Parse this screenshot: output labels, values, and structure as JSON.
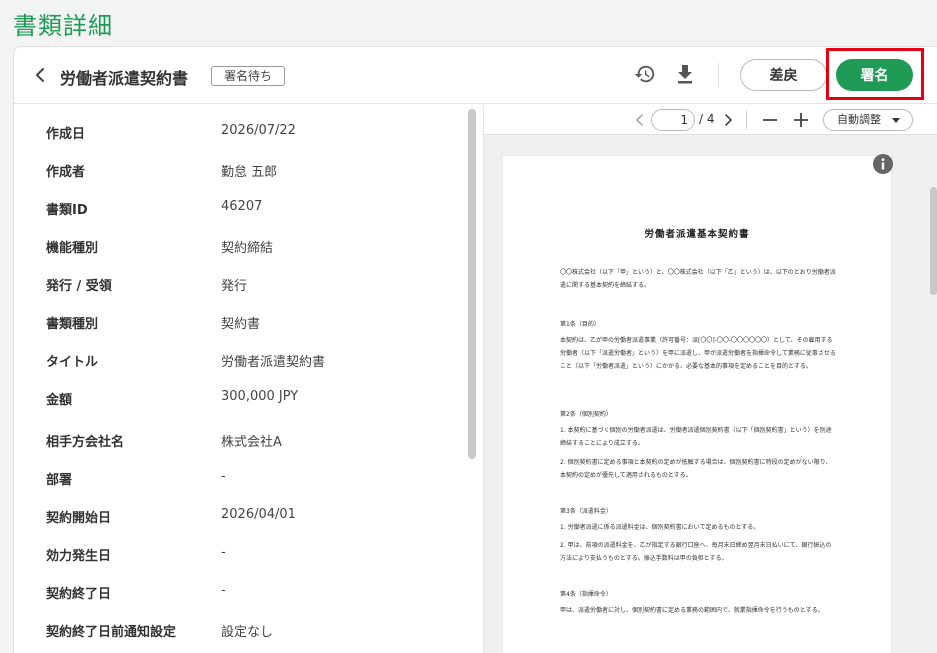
{
  "page_title": "書類詳細",
  "header": {
    "document_title": "労働者派遣契約書",
    "status": "署名待ち",
    "return_label": "差戻",
    "sign_label": "署名"
  },
  "details": [
    {
      "label": "作成日",
      "value": "2026/07/22"
    },
    {
      "label": "作成者",
      "value": "勤怠 五郎"
    },
    {
      "label": "書類ID",
      "value": "46207"
    },
    {
      "label": "機能種別",
      "value": "契約締結"
    },
    {
      "label": "発行 / 受領",
      "value": "発行"
    },
    {
      "label": "書類種別",
      "value": "契約書"
    },
    {
      "label": "タイトル",
      "value": "労働者派遣契約書"
    },
    {
      "label": "金額",
      "value": "300,000 JPY"
    },
    {
      "label": "相手方会社名",
      "value": "株式会社A"
    },
    {
      "label": "部署",
      "value": "-"
    },
    {
      "label": "契約開始日",
      "value": "2026/04/01"
    },
    {
      "label": "効力発生日",
      "value": "-"
    },
    {
      "label": "契約終了日",
      "value": "-"
    },
    {
      "label": "契約終了日前通知設定",
      "value": "設定なし"
    }
  ],
  "viewer": {
    "current_page": "1",
    "total_pages": "/ 4",
    "zoom_label": "自動調整"
  },
  "pdf": {
    "title": "労働者派遣基本契約書",
    "intro": "〇〇株式会社（以下「甲」という）と、〇〇株式会社（以下「乙」という）は、以下のとおり労働者派遣に関する基本契約を締結する。",
    "art1_heading": "第1条（目的）",
    "art1_text": "本契約は、乙が甲の労働者派遣事業（許可番号：派[〇〇]-〇〇-〇〇〇〇〇〇）として、その雇用する労働者（以下「派遣労働者」という）を甲に派遣し、甲が派遣労働者を指揮命令して業務に従事させること（以下「労働者派遣」という）にかかる、必要な基本的事項を定めることを目的とする。",
    "art2_heading": "第2条（個別契約）",
    "art2_text1": "1. 本契約に基づく個別の労働者派遣は、労働者派遣個別契約書（以下「個別契約書」という）を別途締結することにより成立する。",
    "art2_text2": "2. 個別契約書に定める事項と本契約の定めが抵触する場合は、個別契約書に特段の定めがない限り、本契約の定めが優先して適用されるものとする。",
    "art3_heading": "第3条（派遣料金）",
    "art3_text1": "1. 労働者派遣に係る派遣料金は、個別契約書において定めるものとする。",
    "art3_text2": "2. 甲は、前項の派遣料金を、乙が指定する銀行口座へ、毎月末日締め翌月末日払いにて、銀行振込の方法により支払うものとする。振込手数料は甲の負担とする。",
    "art4_heading": "第4条（指揮命令）",
    "art4_text": "甲は、派遣労働者に対し、個別契約書に定める業務の範囲内で、就業指揮命令を行うものとする。"
  },
  "colors": {
    "brand_green": "#1f9b56",
    "highlight_red": "#e60012"
  }
}
